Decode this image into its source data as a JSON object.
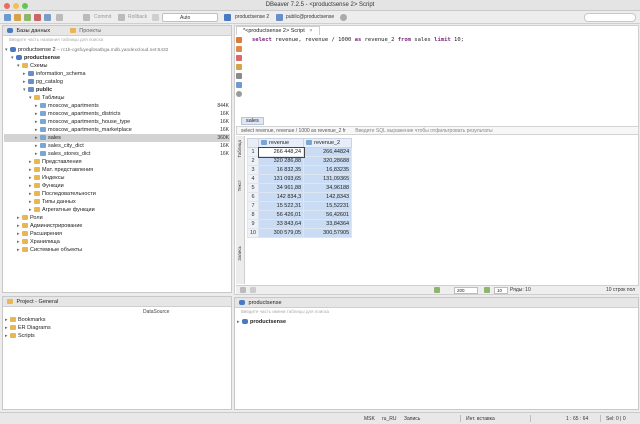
{
  "window": {
    "title": "DBeaver 7.2.5 - <productsense 2> Script"
  },
  "toolbar": {
    "commit_label": "Commit",
    "rollback_label": "Rollback",
    "tx_mode": "Auto",
    "connection": "productsense 2",
    "schema": "public@productsense"
  },
  "db_nav": {
    "tab_databases": "Базы данных",
    "tab_projects": "Проекты",
    "filter_placeholder": "Введите часть названия таблицы для поиска",
    "connection_label": "productsense 2",
    "connection_host": "– rc1b-cgsfuyeqibsatbga.mdb.yandexcloud.net:6432",
    "items": [
      {
        "label": "productsense",
        "count": ""
      },
      {
        "label": "Схемы",
        "count": ""
      },
      {
        "label": "information_schema",
        "count": ""
      },
      {
        "label": "pg_catalog",
        "count": ""
      },
      {
        "label": "public",
        "count": ""
      },
      {
        "label": "Таблицы",
        "count": ""
      },
      {
        "label": "moscow_apartments",
        "count": "844K"
      },
      {
        "label": "moscow_apartments_districts",
        "count": "16K"
      },
      {
        "label": "moscow_apartments_house_type",
        "count": "16K"
      },
      {
        "label": "moscow_apartments_marketplace",
        "count": "16K"
      },
      {
        "label": "sales",
        "count": "360K"
      },
      {
        "label": "sales_city_dict",
        "count": "16K"
      },
      {
        "label": "sales_stores_dict",
        "count": "16K"
      },
      {
        "label": "Представления",
        "count": ""
      },
      {
        "label": "Мат. представления",
        "count": ""
      },
      {
        "label": "Индексы",
        "count": ""
      },
      {
        "label": "Функции",
        "count": ""
      },
      {
        "label": "Последовательности",
        "count": ""
      },
      {
        "label": "Типы данных",
        "count": ""
      },
      {
        "label": "Агрегатные функции",
        "count": ""
      },
      {
        "label": "Роли",
        "count": ""
      },
      {
        "label": "Администрирование",
        "count": ""
      },
      {
        "label": "Расширения",
        "count": ""
      },
      {
        "label": "Хранилища",
        "count": ""
      },
      {
        "label": "Системные объекты",
        "count": ""
      }
    ]
  },
  "project": {
    "title": "Project - General",
    "col_datasource": "DataSource",
    "items": [
      "Bookmarks",
      "ER Diagrams",
      "Scripts"
    ]
  },
  "editor": {
    "tab_label": "*<productsense 2> Script",
    "sql_select": "select",
    "sql_mid": "revenue, revenue / 1000",
    "sql_as": "as",
    "sql_alias": "revenue_2",
    "sql_from": "from",
    "sql_table": "sales",
    "sql_limit": "limit",
    "sql_tail": "10;"
  },
  "results": {
    "tab_label": "sales",
    "query_echo": "select revenue, revenue / 1000 as revenue_2 fr",
    "filter_placeholder": "Введите SQL выражение чтобы отфильтровать результаты",
    "vtab_grid": "Таблица",
    "vtab_text": "Текст",
    "vtab_record": "Запись",
    "columns": [
      "revenue",
      "revenue_2"
    ],
    "rows": [
      [
        "266 448,24",
        "266,44824"
      ],
      [
        "320 286,88",
        "320,28688"
      ],
      [
        "16 832,35",
        "16,83235"
      ],
      [
        "131 093,65",
        "131,09365"
      ],
      [
        "34 961,88",
        "34,96188"
      ],
      [
        "142 834,3",
        "142,8343"
      ],
      [
        "15 522,31",
        "15,52231"
      ],
      [
        "56 426,01",
        "56,42601"
      ],
      [
        "33 843,64",
        "33,84364"
      ],
      [
        "300 579,05",
        "300,57905"
      ]
    ],
    "row_numbers": [
      "1",
      "2",
      "3",
      "4",
      "5",
      "6",
      "7",
      "8",
      "9",
      "10"
    ],
    "fetch_size": "200",
    "fetched_count": "10",
    "rows_label": "Ряды: 10",
    "status_text": "10 строк пол"
  },
  "bottom_nav": {
    "title": "productsense",
    "filter_placeholder": "Введите часть имени таблицы для поиска",
    "item": "productsense"
  },
  "status": {
    "tz": "MSK",
    "locale": "ru_RU",
    "mode": "Запись",
    "insert": "Инт. вставка",
    "position": "1 : 65 : 64",
    "selection": "Sel: 0 | 0"
  }
}
